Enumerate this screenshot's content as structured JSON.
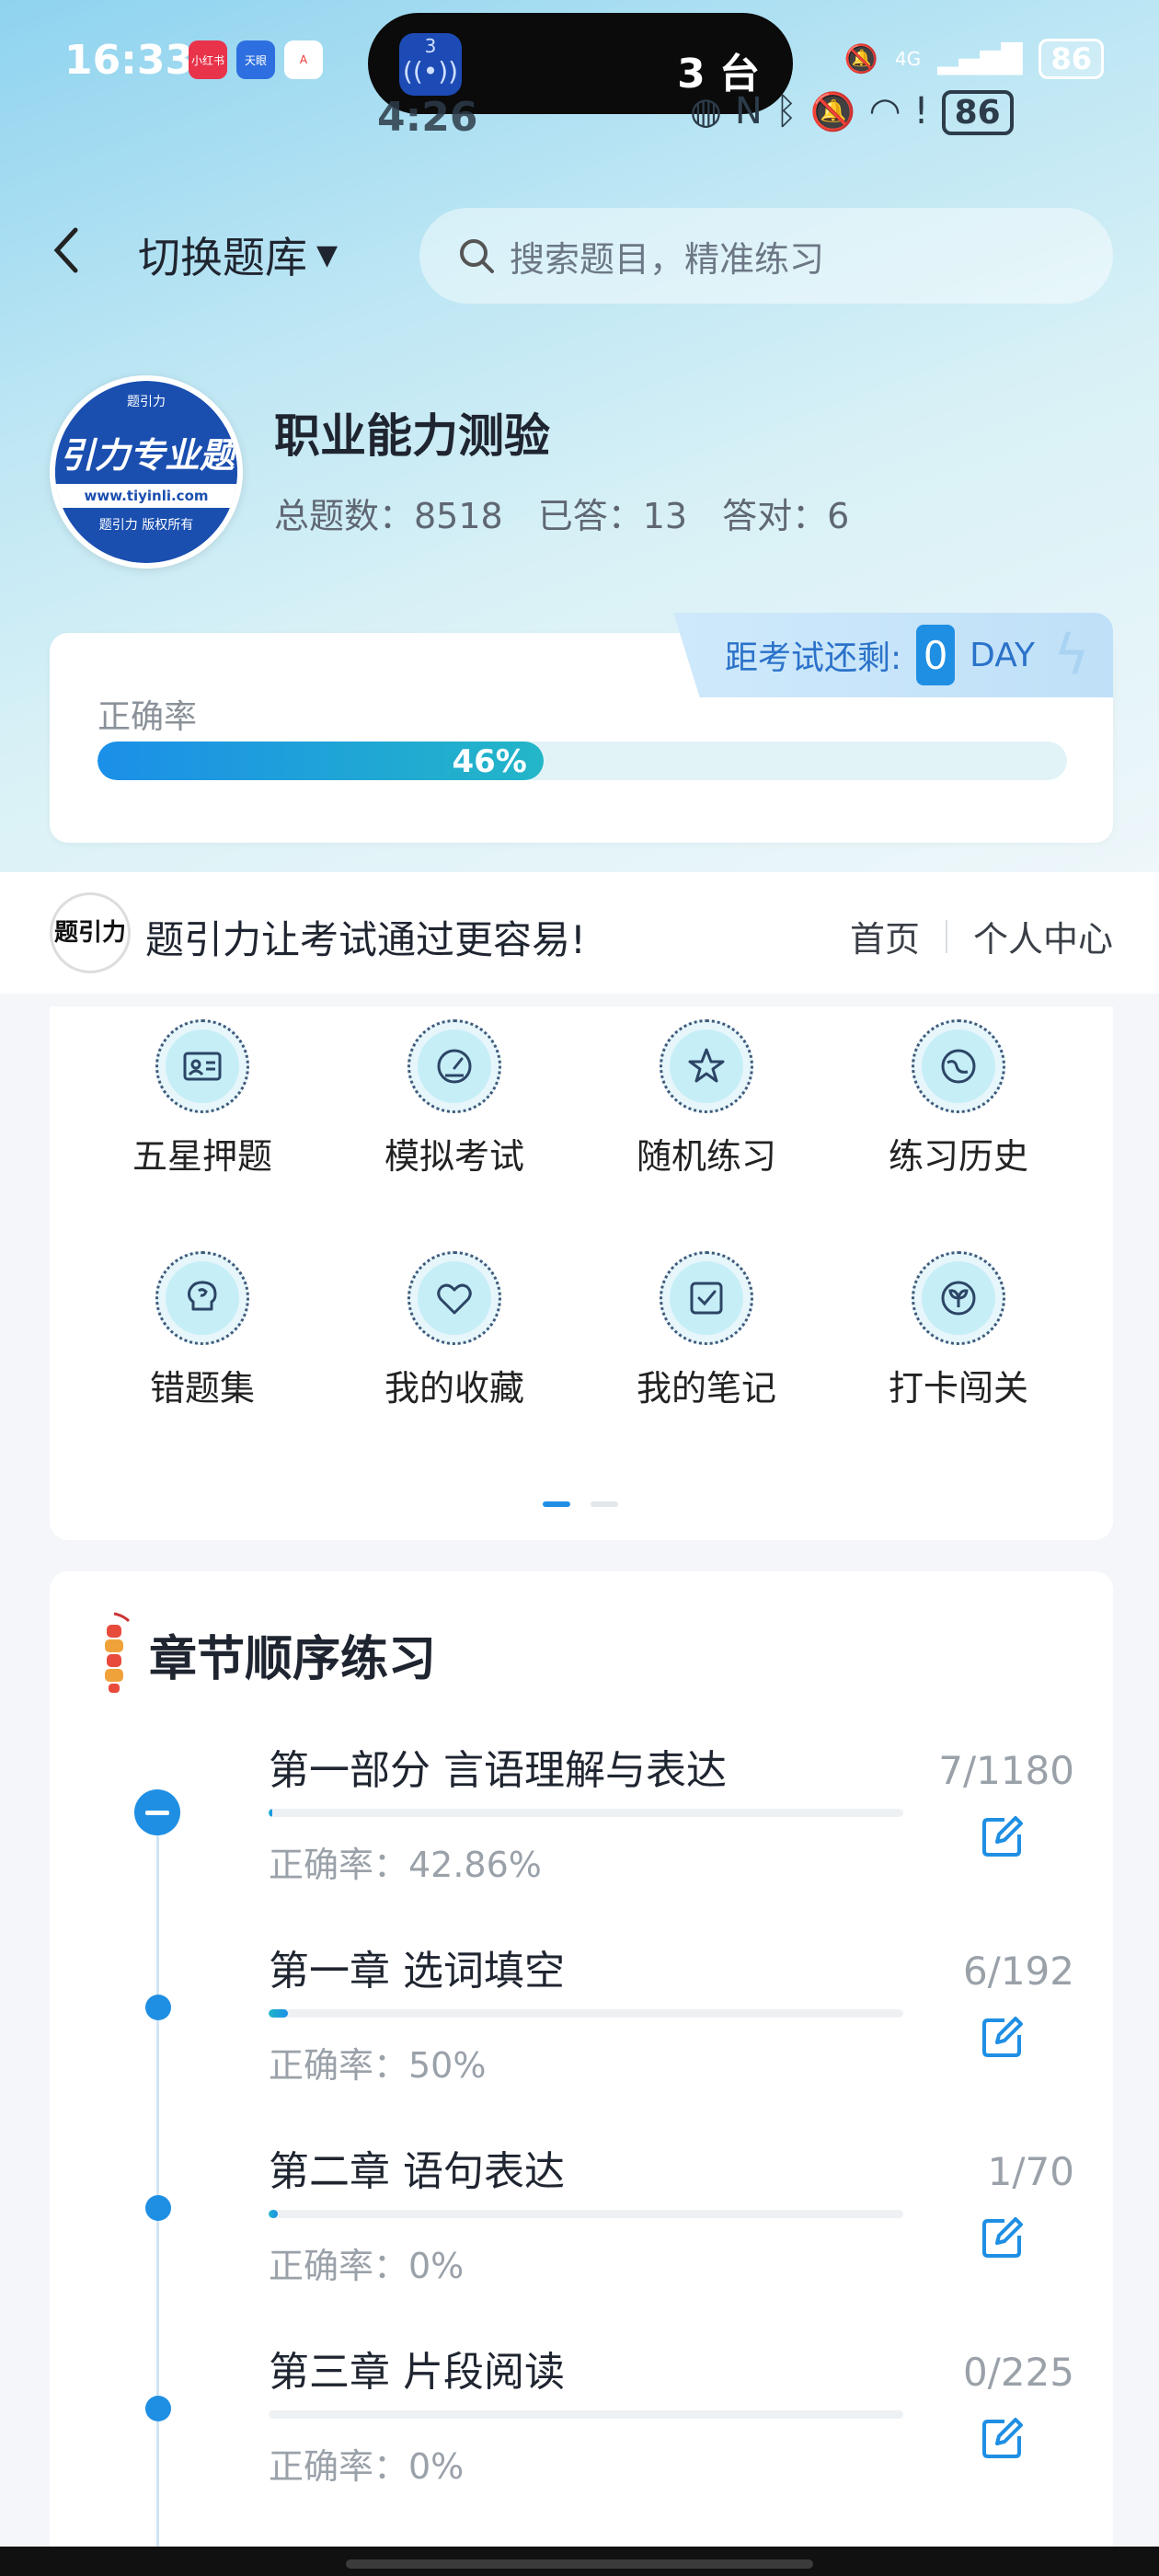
{
  "status_bar": {
    "time": "16:33",
    "apps": [
      "小红书",
      "天眼",
      "A"
    ],
    "island_badge": "3",
    "island_text": "3 台",
    "network": "4G",
    "battery": "86",
    "mirrored_time": "4:26",
    "mirrored_battery": "86"
  },
  "header": {
    "back_label": "‹",
    "switch_bank_label": "切换题库",
    "search_placeholder": "搜索题目，精准练习"
  },
  "bank": {
    "logo_top": "题引力",
    "logo_band": "引力专业题",
    "logo_url": "www.tiyinli.com",
    "logo_bottom": "题引力 版权所有",
    "title": "职业能力测验",
    "total_label": "总题数：8518",
    "answered_label": "已答：13",
    "correct_label": "答对：6"
  },
  "accuracy": {
    "countdown_label": "距考试还剩:",
    "countdown_days": "0",
    "countdown_unit": "DAY",
    "label": "正确率",
    "percent_text": "46%",
    "percent_value": 0.46
  },
  "slogan": {
    "logo_text": "题引力",
    "text": "题引力让考试通过更容易!",
    "nav_home": "首页",
    "nav_profile": "个人中心"
  },
  "features": [
    {
      "label": "五星押题",
      "icon": "id-card-icon"
    },
    {
      "label": "模拟考试",
      "icon": "gauge-icon"
    },
    {
      "label": "随机练习",
      "icon": "shuffle-star-icon"
    },
    {
      "label": "练习历史",
      "icon": "globe-history-icon"
    },
    {
      "label": "错题集",
      "icon": "brain-icon"
    },
    {
      "label": "我的收藏",
      "icon": "heart-icon"
    },
    {
      "label": "我的笔记",
      "icon": "check-note-icon"
    },
    {
      "label": "打卡闯关",
      "icon": "sprout-icon"
    }
  ],
  "chapters": {
    "title": "章节顺序练习",
    "items": [
      {
        "name": "第一部分 言语理解与表达",
        "count": "7/1180",
        "accuracy": "正确率：42.86%",
        "progress": 0.006
      },
      {
        "name": "第一章 选词填空",
        "count": "6/192",
        "accuracy": "正确率：50%",
        "progress": 0.031
      },
      {
        "name": "第二章 语句表达",
        "count": "1/70",
        "accuracy": "正确率：0%",
        "progress": 0.014
      },
      {
        "name": "第三章 片段阅读",
        "count": "0/225",
        "accuracy": "正确率：0%",
        "progress": 0
      }
    ]
  },
  "colors": {
    "accent": "#1f8fe4",
    "progress_end": "#23b6c8",
    "muted_text": "#9aa1a9"
  }
}
